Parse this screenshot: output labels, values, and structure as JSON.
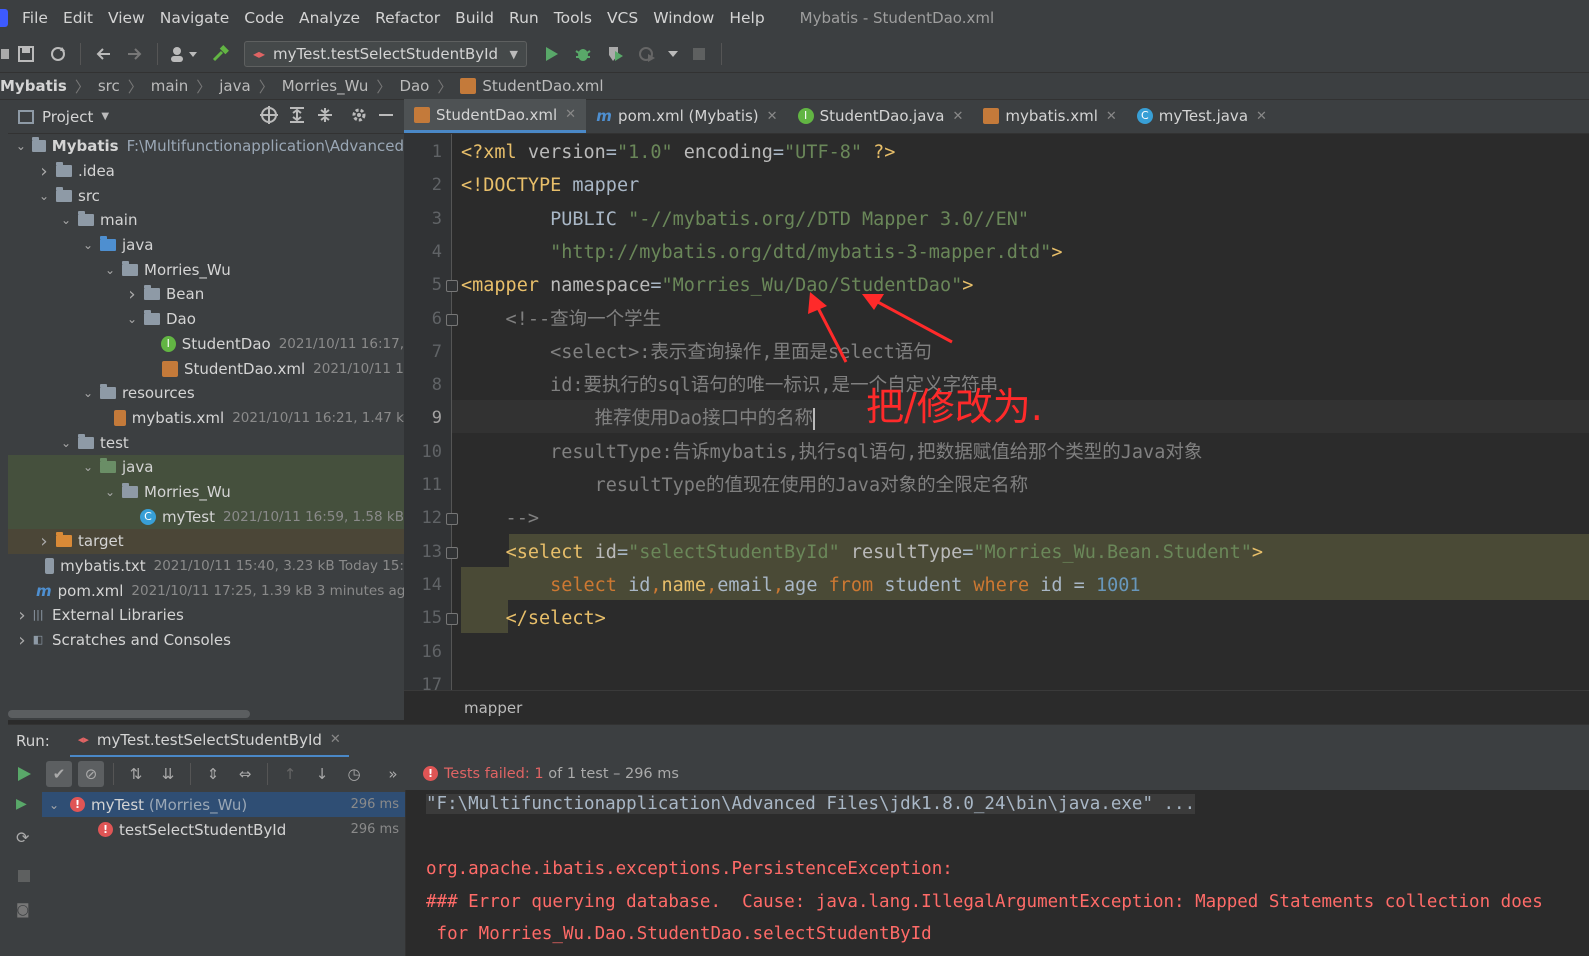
{
  "menu": {
    "items": [
      "File",
      "Edit",
      "View",
      "Navigate",
      "Code",
      "Analyze",
      "Refactor",
      "Build",
      "Run",
      "Tools",
      "VCS",
      "Window",
      "Help"
    ],
    "window_title": "Mybatis - StudentDao.xml"
  },
  "toolbar": {
    "run_config": "myTest.testSelectStudentById",
    "icons": [
      "save-icon",
      "sync-icon",
      "back-icon",
      "forward-icon",
      "user-icon",
      "build-hammer-icon",
      "run-icon",
      "debug-icon",
      "coverage-icon",
      "profile-icon",
      "stop-icon"
    ]
  },
  "breadcrumb": [
    "Mybatis",
    "src",
    "main",
    "java",
    "Morries_Wu",
    "Dao",
    "StudentDao.xml"
  ],
  "project": {
    "title": "Project",
    "tree": [
      {
        "label": "Mybatis",
        "meta": "F:\\Multifunctionapplication\\Advanced",
        "kind": "folder",
        "level": 0,
        "open": true,
        "bold": true
      },
      {
        "label": ".idea",
        "meta": "",
        "kind": "folder",
        "level": 1,
        "open": false
      },
      {
        "label": "src",
        "meta": "",
        "kind": "folder",
        "level": 1,
        "open": true
      },
      {
        "label": "main",
        "meta": "",
        "kind": "folder",
        "level": 2,
        "open": true
      },
      {
        "label": "java",
        "meta": "",
        "kind": "folder-blue",
        "level": 3,
        "open": true
      },
      {
        "label": "Morries_Wu",
        "meta": "",
        "kind": "package",
        "level": 4,
        "open": true
      },
      {
        "label": "Bean",
        "meta": "",
        "kind": "package",
        "level": 5,
        "open": false
      },
      {
        "label": "Dao",
        "meta": "",
        "kind": "package",
        "level": 5,
        "open": true
      },
      {
        "label": "StudentDao",
        "meta": "2021/10/11 16:17,",
        "kind": "interface",
        "level": 6
      },
      {
        "label": "StudentDao.xml",
        "meta": "2021/10/11 1",
        "kind": "xml",
        "level": 6
      },
      {
        "label": "resources",
        "meta": "",
        "kind": "folder-res",
        "level": 3,
        "open": true
      },
      {
        "label": "mybatis.xml",
        "meta": "2021/10/11 16:21, 1.47 k",
        "kind": "xml",
        "level": 4
      },
      {
        "label": "test",
        "meta": "",
        "kind": "folder",
        "level": 2,
        "open": true
      },
      {
        "label": "java",
        "meta": "",
        "kind": "folder-green",
        "level": 3,
        "open": true,
        "hl": true
      },
      {
        "label": "Morries_Wu",
        "meta": "",
        "kind": "package",
        "level": 4,
        "open": true,
        "hl": true
      },
      {
        "label": "myTest",
        "meta": "2021/10/11 16:59, 1.58 kB",
        "kind": "class",
        "level": 5,
        "hl": true
      },
      {
        "label": "target",
        "meta": "",
        "kind": "folder-orange",
        "level": 1,
        "open": false,
        "tg": true
      },
      {
        "label": "mybatis.txt",
        "meta": "2021/10/11 15:40, 3.23 kB Today 15:",
        "kind": "txt",
        "level": 1
      },
      {
        "label": "pom.xml",
        "meta": "2021/10/11 17:25, 1.39 kB 3 minutes ag",
        "kind": "maven",
        "level": 1
      },
      {
        "label": "External Libraries",
        "meta": "",
        "kind": "lib",
        "level": 0,
        "open": false
      },
      {
        "label": "Scratches and Consoles",
        "meta": "",
        "kind": "scratch",
        "level": 0,
        "open": false
      }
    ]
  },
  "tabs": [
    {
      "label": "StudentDao.xml",
      "icon": "xml-file-icon",
      "active": true
    },
    {
      "label": "pom.xml (Mybatis)",
      "icon": "maven-icon",
      "active": false
    },
    {
      "label": "StudentDao.java",
      "icon": "interface-icon",
      "active": false
    },
    {
      "label": "mybatis.xml",
      "icon": "xml-file-icon",
      "active": false
    },
    {
      "label": "myTest.java",
      "icon": "class-icon",
      "active": false
    }
  ],
  "editor": {
    "line_numbers": [
      "1",
      "2",
      "3",
      "4",
      "5",
      "6",
      "7",
      "8",
      "9",
      "10",
      "11",
      "12",
      "13",
      "14",
      "15",
      "16",
      "17"
    ],
    "current_line": "9",
    "lines": [
      [
        [
          "k",
          "<?xml "
        ],
        [
          "an",
          "version"
        ],
        [
          "txt",
          "="
        ],
        [
          "av",
          "\"1.0\""
        ],
        [
          "an",
          " encoding"
        ],
        [
          "txt",
          "="
        ],
        [
          "av",
          "\"UTF-8\""
        ],
        [
          "k",
          " ?>"
        ]
      ],
      [
        [
          "k",
          "<!DOCTYPE "
        ],
        [
          "txt",
          "mapper"
        ]
      ],
      [
        [
          "txt",
          "        PUBLIC "
        ],
        [
          "av",
          "\"-//mybatis.org//DTD Mapper 3.0//EN\""
        ]
      ],
      [
        [
          "txt",
          "        "
        ],
        [
          "av",
          "\"http://mybatis.org/dtd/mybatis-3-mapper.dtd\""
        ],
        [
          "k",
          ">"
        ]
      ],
      [
        [
          "k",
          "<mapper "
        ],
        [
          "an",
          "namespace"
        ],
        [
          "txt",
          "="
        ],
        [
          "av",
          "\"Morries_Wu/Dao/StudentDao\""
        ],
        [
          "k",
          ">"
        ]
      ],
      [
        [
          "cm",
          "    <!--查询一个学生"
        ]
      ],
      [
        [
          "cm",
          "        <select>:表示查询操作,里面是select语句"
        ]
      ],
      [
        [
          "cm",
          "        id:要执行的sql语句的唯一标识,是一个自定义字符串"
        ]
      ],
      [
        [
          "cm",
          "            推荐使用Dao接口中的名称"
        ]
      ],
      [
        [
          "cm",
          "        resultType:告诉mybatis,执行sql语句,把数据赋值给那个类型的Java对象"
        ]
      ],
      [
        [
          "cm",
          "            resultType的值现在使用的Java对象的全限定名称"
        ]
      ],
      [
        [
          "cm",
          "    -->"
        ]
      ],
      [
        [
          "txt",
          "    "
        ],
        [
          "k",
          "<select "
        ],
        [
          "an",
          "id"
        ],
        [
          "txt",
          "="
        ],
        [
          "av",
          "\"selectStudentById\""
        ],
        [
          "an",
          " resultType"
        ],
        [
          "txt",
          "="
        ],
        [
          "av",
          "\"Morries_Wu.Bean.Student\""
        ],
        [
          "k",
          ">"
        ]
      ],
      [
        [
          "txt",
          "        "
        ],
        [
          "sq",
          "select "
        ],
        [
          "txt",
          "id"
        ],
        [
          "sq",
          ","
        ],
        [
          "k",
          "name"
        ],
        [
          "sq",
          ","
        ],
        [
          "txt",
          "email"
        ],
        [
          "sq",
          ","
        ],
        [
          "txt",
          "age "
        ],
        [
          "sq",
          "from "
        ],
        [
          "txt",
          "student "
        ],
        [
          "sq",
          "where "
        ],
        [
          "txt",
          "id = "
        ],
        [
          "num",
          "1001"
        ]
      ],
      [
        [
          "txt",
          "    "
        ],
        [
          "k",
          "</select>"
        ]
      ],
      [],
      []
    ],
    "annotation": "把/修改为."
  },
  "editor_breadcrumb": "mapper",
  "run": {
    "label": "Run:",
    "tab": "myTest.testSelectStudentById",
    "status_prefix": "Tests failed:",
    "status_count": "1",
    "status_rest": "of 1 test – 296 ms",
    "tests": [
      {
        "name": "myTest",
        "pkg": "(Morries_Wu)",
        "time": "296 ms"
      },
      {
        "name": "testSelectStudentById",
        "pkg": "",
        "time": "296 ms"
      }
    ],
    "console": [
      "\"F:\\Multifunctionapplication\\Advanced Files\\jdk1.8.0_24\\bin\\java.exe\" ...",
      "",
      "org.apache.ibatis.exceptions.PersistenceException:",
      "### Error querying database.  Cause: java.lang.IllegalArgumentException: Mapped Statements collection does",
      " for Morries_Wu.Dao.StudentDao.selectStudentById"
    ]
  },
  "colors": {
    "accent": "#4a88c7",
    "error": "#e05555",
    "annotation": "#ff2a2a"
  }
}
